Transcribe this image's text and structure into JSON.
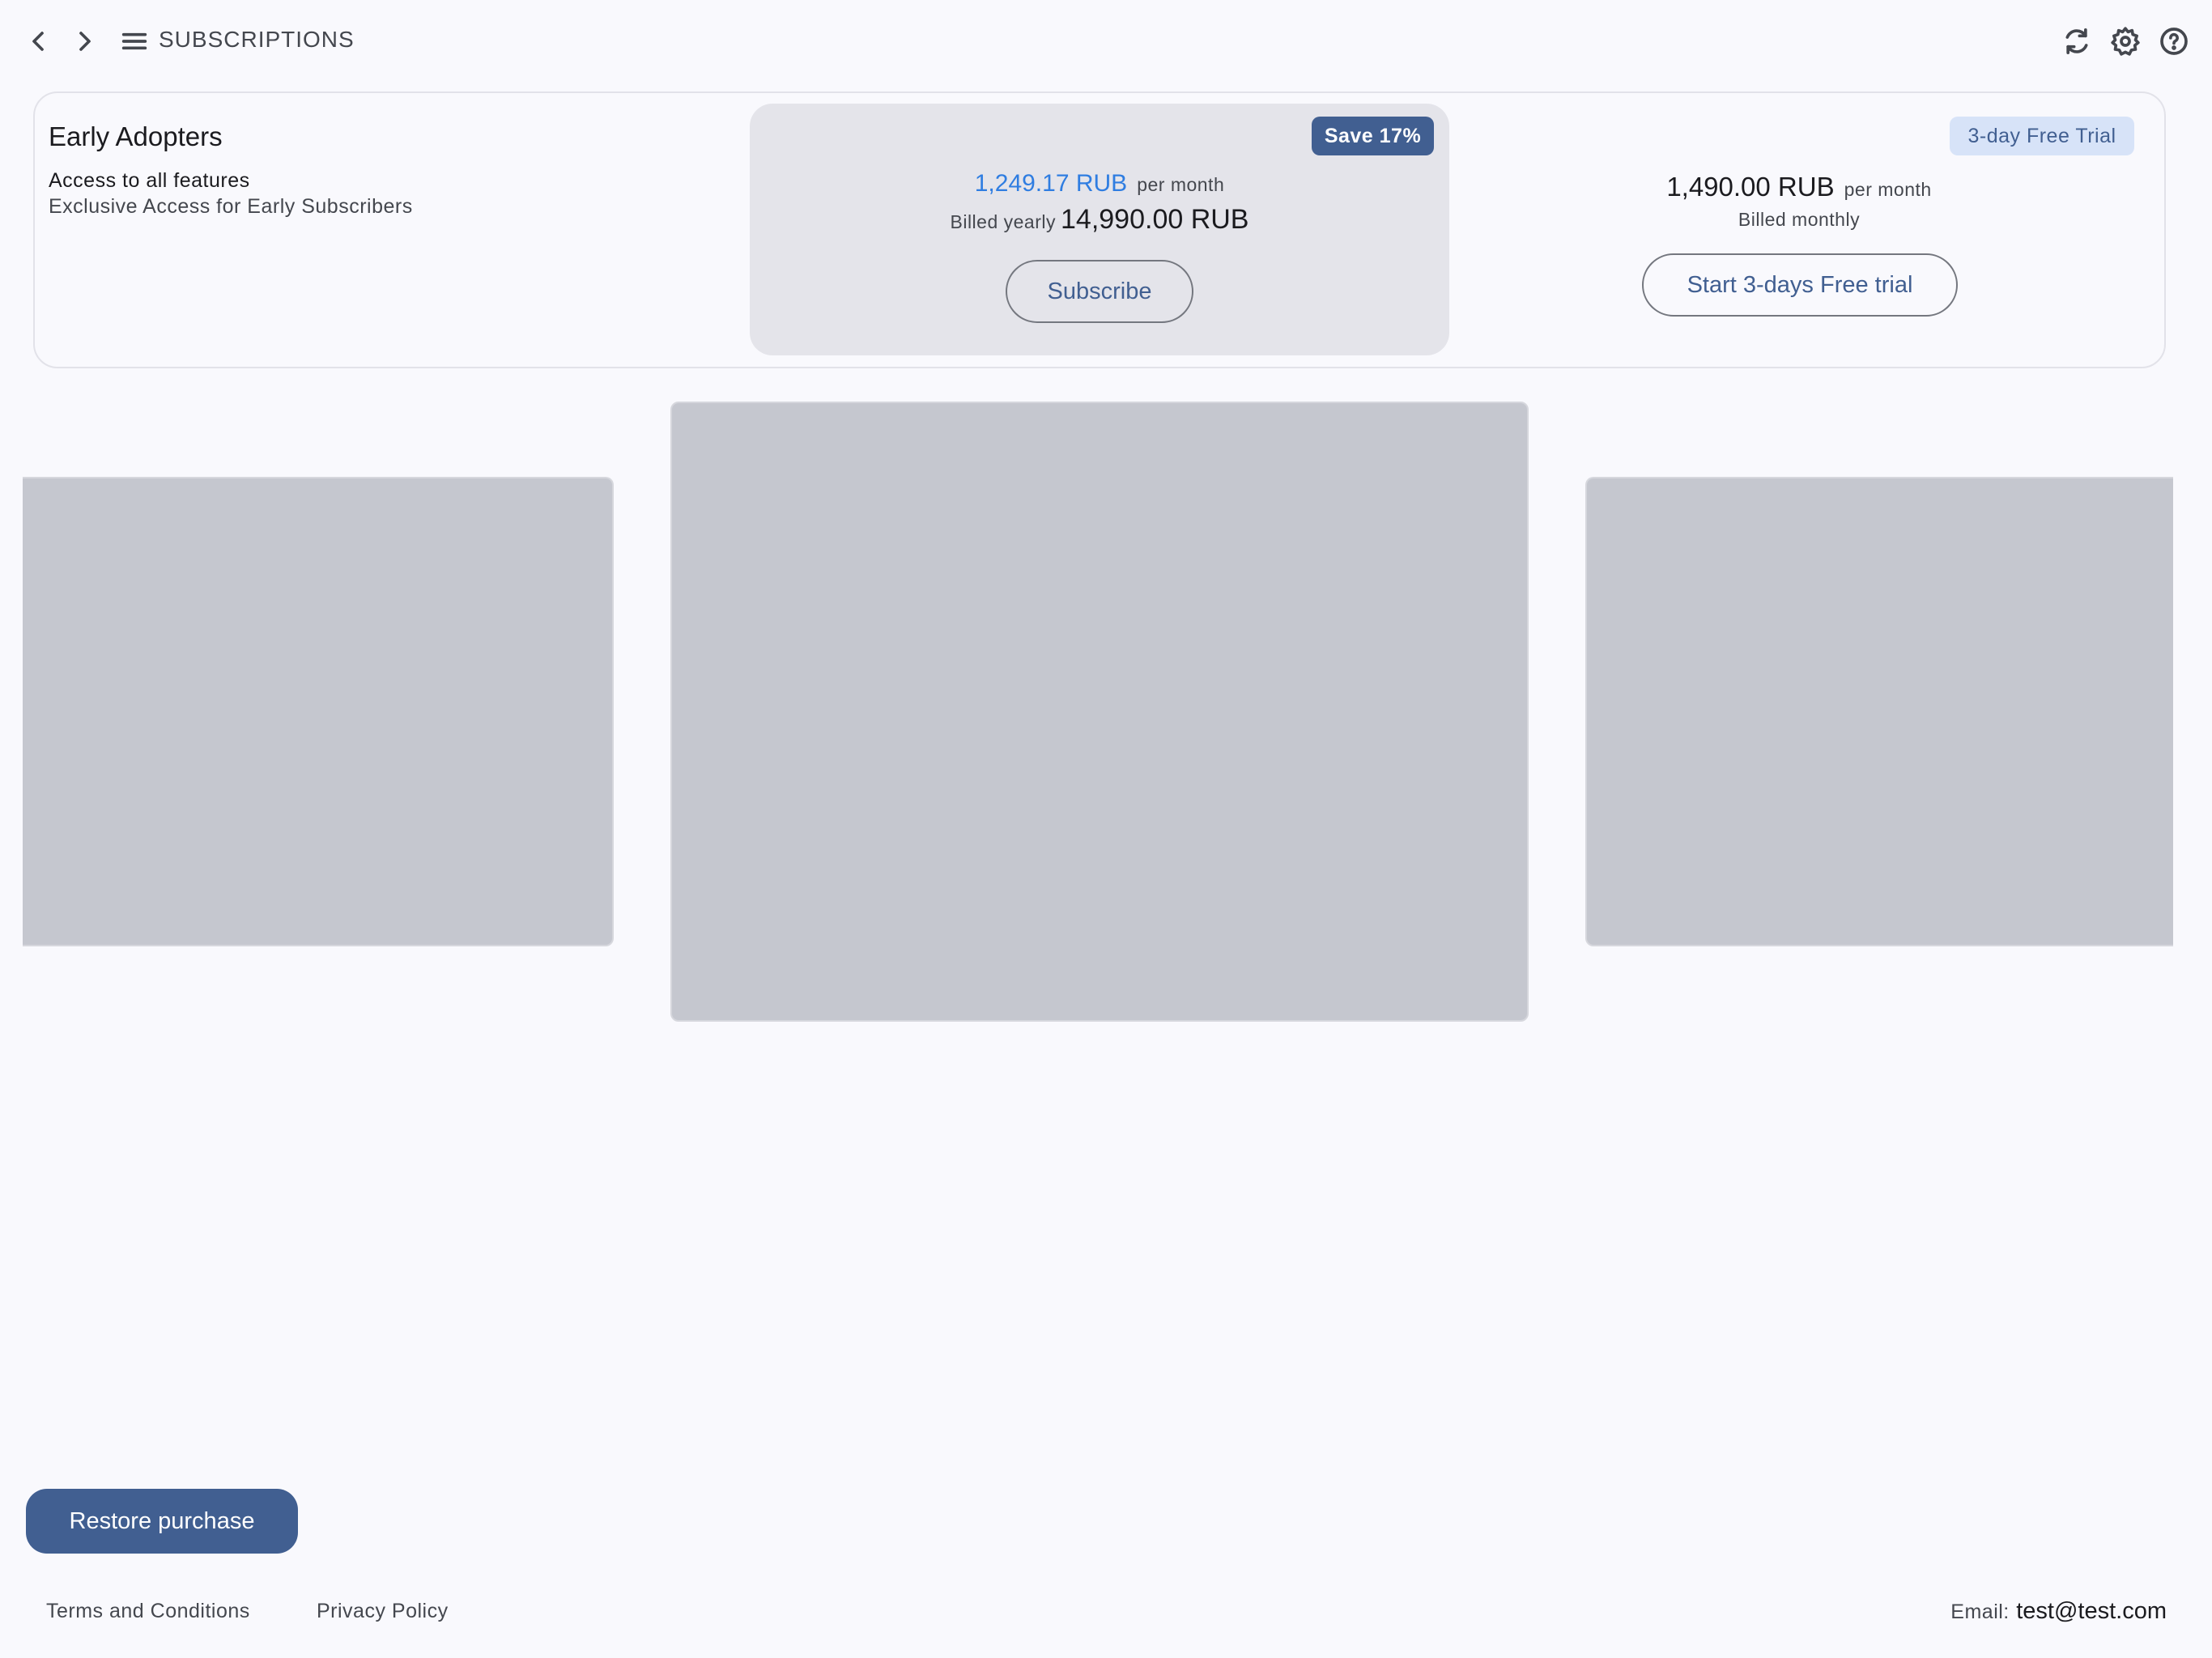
{
  "header": {
    "title": "SUBSCRIPTIONS",
    "icons": [
      "back-icon",
      "forward-icon",
      "menu-icon",
      "refresh-icon",
      "settings-icon",
      "help-icon"
    ]
  },
  "plan": {
    "name": "Early Adopters",
    "feature": "Access to all features",
    "description": "Exclusive Access for Early Subscribers",
    "yearly": {
      "badge": "Save 17%",
      "monthly_equivalent": "1,249.17 RUB",
      "per_label": "per month",
      "billed_label": "Billed yearly",
      "billed_amount": "14,990.00 RUB",
      "button_label": "Subscribe"
    },
    "monthly": {
      "badge": "3-day Free Trial",
      "price": "1,490.00 RUB",
      "per_label": "per month",
      "billed_label": "Billed monthly",
      "button_label": "Start 3-days Free trial"
    }
  },
  "footer": {
    "restore_label": "Restore purchase",
    "terms_label": "Terms and Conditions",
    "privacy_label": "Privacy Policy",
    "email_label": "Email:",
    "email_value": "test@test.com"
  },
  "colors": {
    "background": "#f9f9fd",
    "primary": "#415f91",
    "accent_price": "#2f7de1",
    "card_highlight": "#e4e4ea",
    "placeholder": "#c5c7cf"
  }
}
